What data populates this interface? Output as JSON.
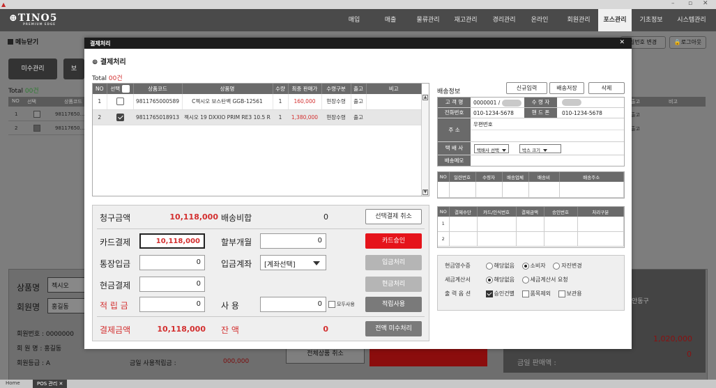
{
  "app": {
    "logo": "TINO5",
    "logo_sub": "PREMIUM EDGE",
    "window_controls": [
      "–",
      "▫",
      "✕"
    ]
  },
  "nav": [
    "매입",
    "매출",
    "물류관리",
    "재고관리",
    "경리관리",
    "온라인",
    "회원관리",
    "포스관리",
    "기초정보",
    "시스템관리"
  ],
  "nav_active": "포스관리",
  "background": {
    "menu_close": "메뉴닫기",
    "btn_unpaid_mgmt": "미수관리",
    "btn_second": "보",
    "btn_pw_change": "일번호 변경",
    "btn_logout": "로그아웃",
    "total_label": "Total",
    "total_count": "00건",
    "thead": [
      "NO",
      "선택",
      "상품코드",
      "출고",
      "비고"
    ],
    "rows": [
      {
        "no": "1",
        "code": "98117650...",
        "checked": false,
        "out": "출고"
      },
      {
        "no": "2",
        "code": "98117650...",
        "checked": true,
        "out": "출고"
      }
    ],
    "product_name_label": "상품명",
    "product_name_value": "젝시오",
    "member_name_label": "회원명",
    "member_name_value": "홍길동",
    "member_no": "회원번호  :  0000000",
    "member_name_line": "회 원 명  :  홍길동",
    "member_grade": "회원등급  :  A",
    "today_points_label": "금일 사용적립금  :",
    "today_points_value": "000,000",
    "all_cancel_btn": "전체상품 취소",
    "right_amount": "1,020,000",
    "right_zero": "0",
    "right_label": "금일 판매액      :",
    "right_partial": "안동구"
  },
  "tabs": {
    "home": "Home",
    "pos": "POS 관리"
  },
  "modal": {
    "header": "결제처리",
    "subtitle": "결제처리",
    "total_label": "Total",
    "total_count": "00건",
    "columns": [
      "NO",
      "선택",
      "상품코드",
      "상품명",
      "수량",
      "최종 판매가",
      "수령구분",
      "출고",
      "비고"
    ],
    "rows": [
      {
        "no": "1",
        "checked": false,
        "code": "9811765000589",
        "name": "C젝시오 보스탄백 GGB-12561",
        "qty": "1",
        "price": "160,000",
        "receive": "현장수령",
        "out": "출고",
        "note": ""
      },
      {
        "no": "2",
        "checked": true,
        "code": "9811765018913",
        "name": "젝시오 19 DXXIO PRIM RE3 10.5 R",
        "qty": "1",
        "price": "1,380,000",
        "receive": "현장수령",
        "out": "출고",
        "note": ""
      }
    ],
    "pay": {
      "bill_label": "청구금액",
      "bill_value": "10,118,000",
      "shipping_label": "배송비합",
      "shipping_value": "0",
      "cancel_sel_btn": "선택결제 취소",
      "card_label": "카드결제",
      "card_value": "10,118,000",
      "installment_label": "할부개월",
      "installment_value": "0",
      "card_btn": "카드승인",
      "bank_label": "통장입금",
      "bank_value": "0",
      "deposit_acct_label": "입금계좌",
      "deposit_acct_value": "[계좌선택]",
      "deposit_btn": "입금처리",
      "cash_label": "현금결제",
      "cash_value": "0",
      "cash_btn": "현금처리",
      "points_label": "적 립 금",
      "points_value": "0",
      "use_label": "사       용",
      "use_value": "0",
      "use_all_label": "모두사용",
      "points_btn": "적립사용",
      "pay_amount_label": "결제금액",
      "pay_amount_value": "10,118,000",
      "balance_label": "잔      액",
      "balance_value": "0",
      "all_unpaid_btn": "전액 미수처리"
    },
    "shipping": {
      "title": "배송정보",
      "btn_new": "신규입력",
      "btn_save": "배송저장",
      "btn_delete": "삭제",
      "customer_label": "고 객 명",
      "customer_value": "0000001 /",
      "receiver_label": "수 령 자",
      "phone_label": "전화번호",
      "phone_value": "010-1234-5678",
      "mobile_label": "핸 드 폰",
      "mobile_value": "010-1234-5678",
      "address_label": "주      소",
      "zip_label": "우편번호",
      "courier_label": "택 배 사",
      "courier_value": "택배사 선택",
      "box_value": "박스 크기",
      "memo_label": "배송메모"
    },
    "ship_table": {
      "columns": [
        "NO",
        "일련번호",
        "수령자",
        "배송업체",
        "배송비",
        "배송주소"
      ]
    },
    "pay_table": {
      "columns": [
        "NO",
        "결제수단",
        "카드/인식번호",
        "결제금액",
        "승인번호",
        "처리구분"
      ],
      "rows": [
        "1",
        "2"
      ]
    },
    "options": {
      "receipt_label": "현금영수증",
      "receipt_opts": [
        "해당없음",
        "소비자",
        "자진변경"
      ],
      "tax_label": "세금계산서",
      "tax_opts": [
        "해당없음",
        "세금계산서 요청"
      ],
      "print_label": "출 력 옵 션",
      "print_opts": [
        "승인건별",
        "품목제외",
        "보관용"
      ]
    }
  }
}
